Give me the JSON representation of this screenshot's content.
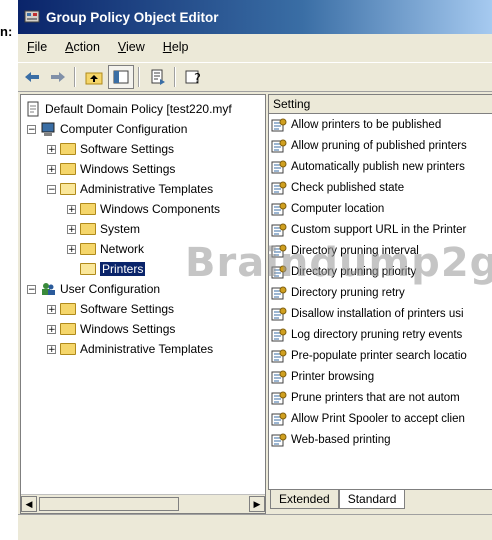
{
  "stray_text": "n:",
  "window": {
    "title": "Group Policy Object Editor"
  },
  "menu": [
    {
      "label": "File",
      "accel": "F",
      "rest": "ile"
    },
    {
      "label": "Action",
      "accel": "A",
      "rest": "ction"
    },
    {
      "label": "View",
      "accel": "V",
      "rest": "iew"
    },
    {
      "label": "Help",
      "accel": "H",
      "rest": "elp"
    }
  ],
  "toolbar": [
    "back-icon",
    "forward-icon",
    "up-one-level-icon",
    "show-hide-tree-icon",
    "export-list-icon",
    "help-icon"
  ],
  "tree": {
    "root": "Default Domain Policy [test220.myf",
    "computer_config": "Computer Configuration",
    "cc_software": "Software Settings",
    "cc_windows": "Windows Settings",
    "cc_admin": "Administrative Templates",
    "windows_components": "Windows Components",
    "system": "System",
    "network": "Network",
    "printers": "Printers",
    "user_config": "User Configuration",
    "uc_software": "Software Settings",
    "uc_windows": "Windows Settings",
    "uc_admin": "Administrative Templates"
  },
  "list": {
    "column": "Setting",
    "settings": [
      "Allow printers to be published",
      "Allow pruning of published printers",
      "Automatically publish new printers",
      "Check published state",
      "Computer location",
      "Custom support URL in the Printer",
      "Directory pruning interval",
      "Directory pruning priority",
      "Directory pruning retry",
      "Disallow installation of printers usi",
      "Log directory pruning retry events",
      "Pre-populate printer search locatio",
      "Printer browsing",
      "Prune printers that are not autom",
      "Allow Print Spooler to accept clien",
      "Web-based printing"
    ]
  },
  "tabs": {
    "extended": "Extended",
    "standard": "Standard"
  },
  "watermark": "Braindump2g",
  "colors": {
    "title_start": "#0a246a",
    "title_end": "#a6caf0",
    "selection": "#0a246a",
    "face": "#ece9d8"
  }
}
